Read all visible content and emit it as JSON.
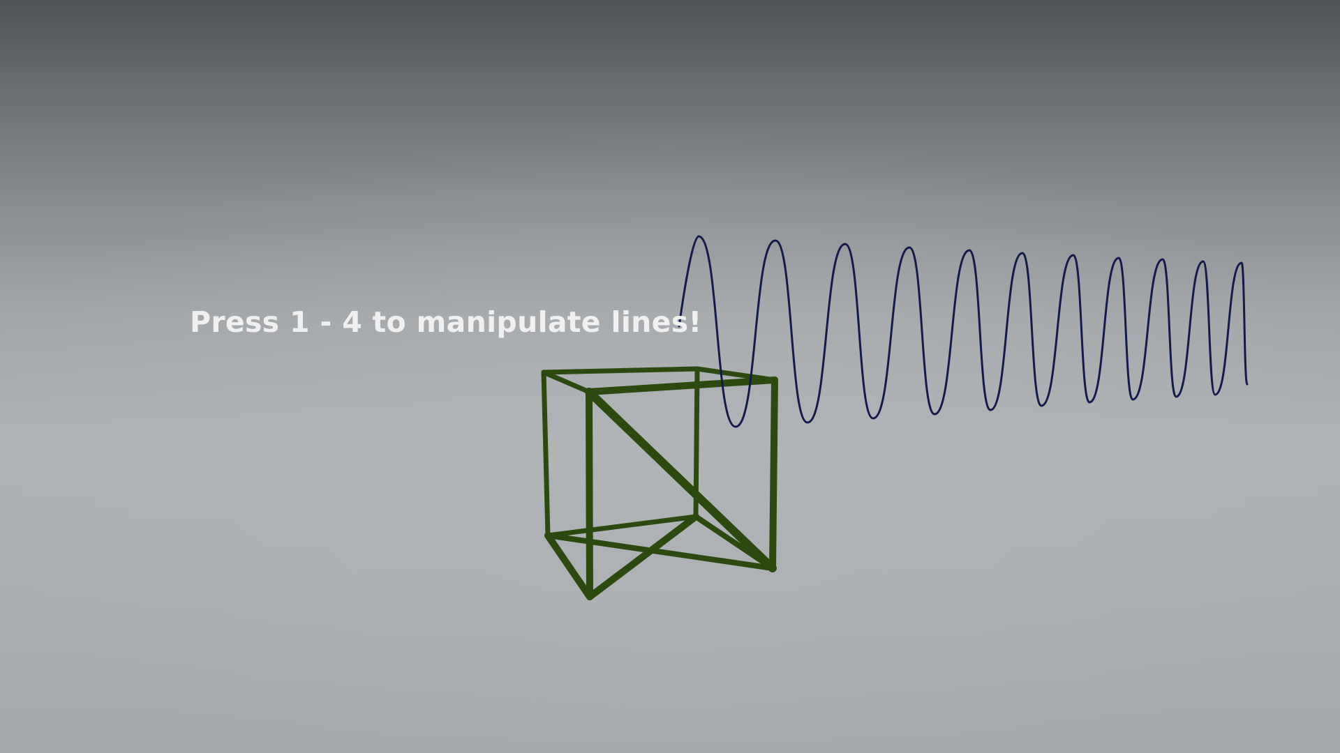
{
  "hud": {
    "instruction": "Press 1 - 4 to manipulate lines!"
  },
  "colors": {
    "sine_wave": "#141a4a",
    "cube_frame": "#2c4a10"
  }
}
